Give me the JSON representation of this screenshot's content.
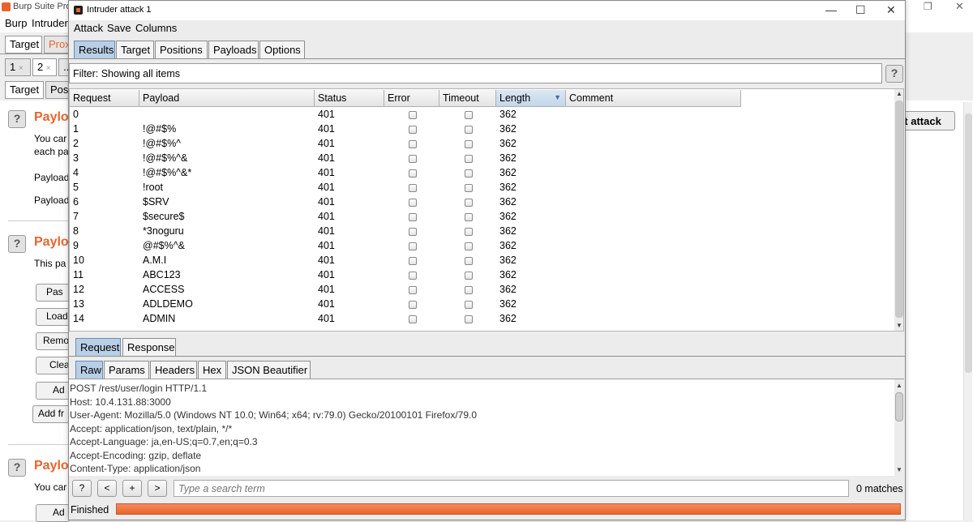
{
  "main_window": {
    "title": "Burp Suite Profe",
    "menu": [
      "Burp",
      "Intruder"
    ],
    "top_tabs": [
      "Target",
      "Prox"
    ],
    "attack_tabs": [
      "1",
      "2",
      "..."
    ],
    "sub_tabs": [
      "Target",
      "Pos"
    ],
    "start_attack_label": "art attack",
    "sections": [
      {
        "heading": "Paylo",
        "text_lines": [
          "You car",
          "each pa"
        ],
        "fields": [
          "Payload",
          "Payload"
        ]
      },
      {
        "heading": "Paylo",
        "text_lines": [
          "This pa"
        ],
        "buttons": [
          "Pas",
          "Load",
          "Remo",
          "Clea",
          "Ad",
          "Add fr"
        ]
      },
      {
        "heading": "Paylo",
        "text_lines": [
          "You car"
        ],
        "buttons": [
          "Ad"
        ]
      }
    ],
    "help_label": "?"
  },
  "attack_window": {
    "title": "Intruder attack 1",
    "controls": {
      "minimize": "—",
      "maximize": "☐",
      "close": "✕"
    },
    "menu": [
      "Attack",
      "Save",
      "Columns"
    ],
    "tabs": [
      "Results",
      "Target",
      "Positions",
      "Payloads",
      "Options"
    ],
    "active_tab": "Results",
    "filter_text": "Filter: Showing all items",
    "help_label": "?",
    "results": {
      "columns": [
        "Request",
        "Payload",
        "Status",
        "Error",
        "Timeout",
        "Length",
        "Comment"
      ],
      "sorted_column": "Length",
      "sort_glyph": "▼",
      "rows": [
        {
          "request": "0",
          "payload": "",
          "status": "401",
          "error": false,
          "timeout": false,
          "length": "362",
          "comment": ""
        },
        {
          "request": "1",
          "payload": "!@#$%",
          "status": "401",
          "error": false,
          "timeout": false,
          "length": "362",
          "comment": ""
        },
        {
          "request": "2",
          "payload": "!@#$%^",
          "status": "401",
          "error": false,
          "timeout": false,
          "length": "362",
          "comment": ""
        },
        {
          "request": "3",
          "payload": "!@#$%^&",
          "status": "401",
          "error": false,
          "timeout": false,
          "length": "362",
          "comment": ""
        },
        {
          "request": "4",
          "payload": "!@#$%^&*",
          "status": "401",
          "error": false,
          "timeout": false,
          "length": "362",
          "comment": ""
        },
        {
          "request": "5",
          "payload": "!root",
          "status": "401",
          "error": false,
          "timeout": false,
          "length": "362",
          "comment": ""
        },
        {
          "request": "6",
          "payload": "$SRV",
          "status": "401",
          "error": false,
          "timeout": false,
          "length": "362",
          "comment": ""
        },
        {
          "request": "7",
          "payload": "$secure$",
          "status": "401",
          "error": false,
          "timeout": false,
          "length": "362",
          "comment": ""
        },
        {
          "request": "8",
          "payload": "*3noguru",
          "status": "401",
          "error": false,
          "timeout": false,
          "length": "362",
          "comment": ""
        },
        {
          "request": "9",
          "payload": "@#$%^&",
          "status": "401",
          "error": false,
          "timeout": false,
          "length": "362",
          "comment": ""
        },
        {
          "request": "10",
          "payload": "A.M.I",
          "status": "401",
          "error": false,
          "timeout": false,
          "length": "362",
          "comment": ""
        },
        {
          "request": "11",
          "payload": "ABC123",
          "status": "401",
          "error": false,
          "timeout": false,
          "length": "362",
          "comment": ""
        },
        {
          "request": "12",
          "payload": "ACCESS",
          "status": "401",
          "error": false,
          "timeout": false,
          "length": "362",
          "comment": ""
        },
        {
          "request": "13",
          "payload": "ADLDEMO",
          "status": "401",
          "error": false,
          "timeout": false,
          "length": "362",
          "comment": ""
        },
        {
          "request": "14",
          "payload": "ADMIN",
          "status": "401",
          "error": false,
          "timeout": false,
          "length": "362",
          "comment": ""
        }
      ]
    },
    "message_tabs": [
      "Request",
      "Response"
    ],
    "active_message_tab": "Request",
    "view_tabs": [
      "Raw",
      "Params",
      "Headers",
      "Hex",
      "JSON Beautifier"
    ],
    "active_view_tab": "Raw",
    "request_lines": [
      "POST /rest/user/login HTTP/1.1",
      "Host: 10.4.131.88:3000",
      "User-Agent: Mozilla/5.0 (Windows NT 10.0; Win64; x64; rv:79.0) Gecko/20100101 Firefox/79.0",
      "Accept: application/json, text/plain, */*",
      "Accept-Language: ja,en-US;q=0.7,en;q=0.3",
      "Accept-Encoding: gzip, deflate",
      "Content-Type: application/json"
    ],
    "search": {
      "buttons": [
        "?",
        "<",
        "+",
        ">"
      ],
      "placeholder": "Type a search term",
      "matches": "0 matches"
    },
    "status_text": "Finished",
    "progress": 1.0,
    "colors": {
      "accent": "#e8642c",
      "tab_active": "#b8cfe5"
    }
  }
}
